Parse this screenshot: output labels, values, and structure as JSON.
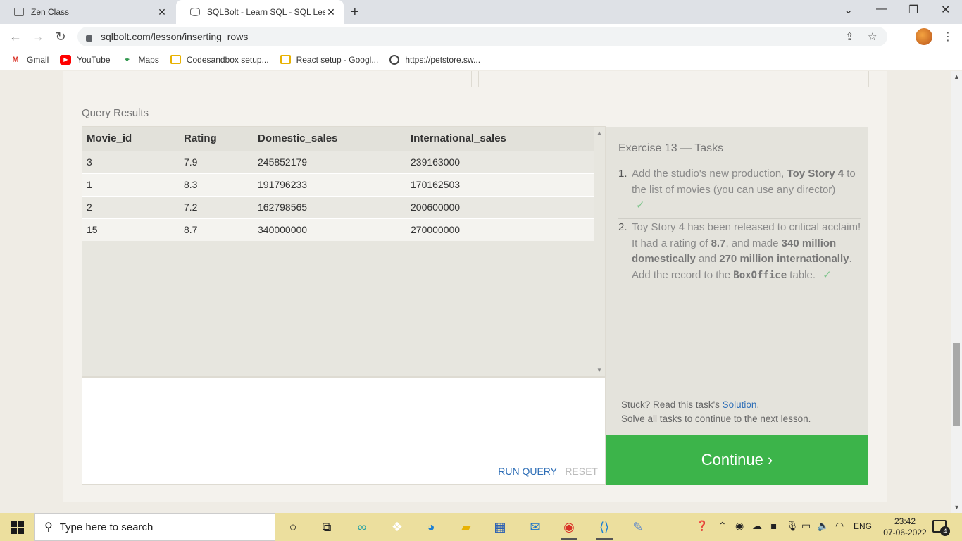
{
  "browser": {
    "tabs": [
      {
        "title": "Zen Class",
        "active": false
      },
      {
        "title": "SQLBolt - Learn SQL - SQL Lesson",
        "active": true
      }
    ],
    "url": "sqlbolt.com/lesson/inserting_rows",
    "bookmarks": [
      {
        "label": "Gmail",
        "icon": "gmail-icon"
      },
      {
        "label": "YouTube",
        "icon": "youtube-icon"
      },
      {
        "label": "Maps",
        "icon": "maps-icon"
      },
      {
        "label": "Codesandbox setup...",
        "icon": "folder-icon"
      },
      {
        "label": "React setup - Googl...",
        "icon": "folder-icon"
      },
      {
        "label": "https://petstore.sw...",
        "icon": "globe-icon"
      }
    ]
  },
  "lesson": {
    "query_results_label": "Query Results",
    "columns": [
      "Movie_id",
      "Rating",
      "Domestic_sales",
      "International_sales"
    ],
    "rows": [
      [
        "3",
        "7.9",
        "245852179",
        "239163000"
      ],
      [
        "1",
        "8.3",
        "191796233",
        "170162503"
      ],
      [
        "2",
        "7.2",
        "162798565",
        "200600000"
      ],
      [
        "15",
        "8.7",
        "340000000",
        "270000000"
      ]
    ],
    "run_query": "RUN QUERY",
    "reset": "RESET",
    "tasks_title": "Exercise 13 — Tasks",
    "task1": {
      "num": "1.",
      "pre": "Add the studio's new production, ",
      "bold": "Toy Story 4",
      "post": " to the list of movies (you can use any director)",
      "check": "✓"
    },
    "task2": {
      "num": "2.",
      "t1": "Toy Story 4 has been released to critical acclaim! It had a rating of ",
      "b1": "8.7",
      "t2": ", and made ",
      "b2": "340 million domestically",
      "t3": " and ",
      "b3": "270 million internationally",
      "t4": ". Add the record to the ",
      "code": "BoxOffice",
      "t5": " table.",
      "check": "✓"
    },
    "stuck_pre": "Stuck? Read this task's ",
    "stuck_link": "Solution",
    "stuck_post": ".",
    "solve_all": "Solve all tasks to continue to the next lesson.",
    "continue": "Continue ›",
    "continue_color": "#3cb44a"
  },
  "taskbar": {
    "search_placeholder": "Type here to search",
    "language": "ENG",
    "time": "23:42",
    "date": "07-06-2022",
    "notifications": "4"
  }
}
